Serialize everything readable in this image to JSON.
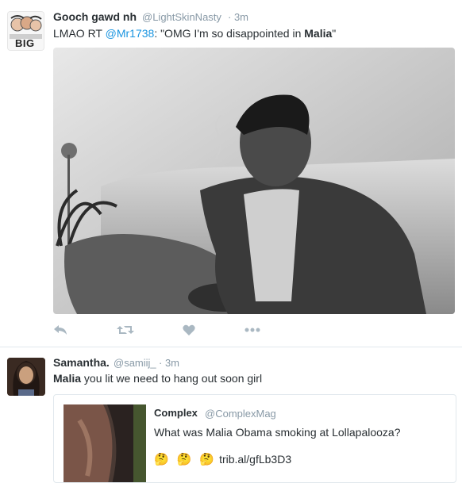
{
  "tweet1": {
    "display_name": "Gooch gawd nh",
    "handle": "@LightSkinNasty",
    "time": "· 3m",
    "avatar_text": "BIG",
    "text_prefix": "LMAO RT ",
    "mention": "@Mr1738",
    "text_middle": ": \"OMG I'm so disappointed in ",
    "highlight": "Malia",
    "text_suffix": "\"",
    "actions": [
      "reply-icon",
      "retweet-icon",
      "like-icon",
      "more-icon"
    ]
  },
  "tweet2": {
    "display_name": "Samantha.",
    "handle": "@samiij_",
    "time": "· 3m",
    "highlight": "Malia",
    "text_rest": " you lit we need to hang out soon girl",
    "quote": {
      "display_name": "Complex",
      "handle": "@ComplexMag",
      "text": "What was Malia Obama smoking at Lollapalooza?",
      "emojis": [
        "🤔",
        "🤔",
        "🤔"
      ],
      "link": "trib.al/gfLb3D3"
    }
  },
  "colors": {
    "link": "#1b95e0",
    "muted": "#8899a6",
    "text": "#292f33",
    "divider": "#e1e8ed",
    "action_icon": "#aab8c2"
  }
}
